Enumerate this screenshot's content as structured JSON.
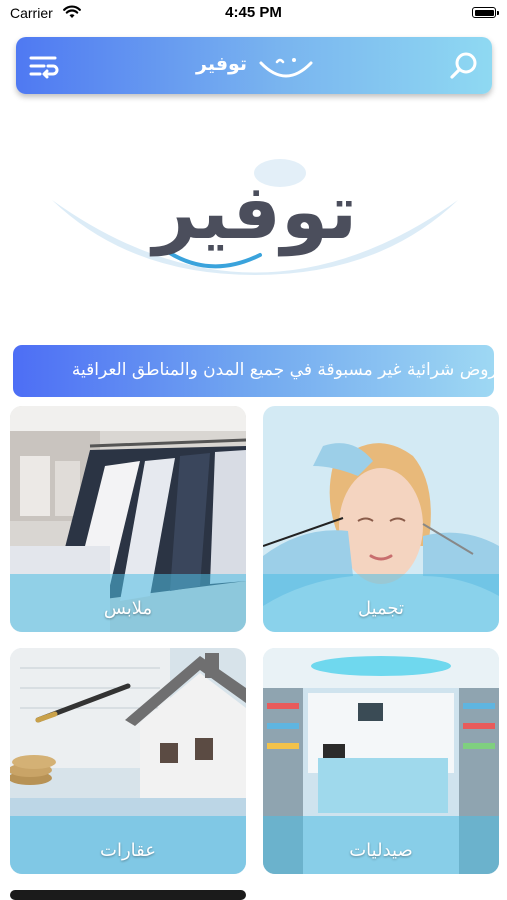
{
  "status_bar": {
    "carrier": "Carrier",
    "time": "4:45 PM"
  },
  "header": {
    "brand": "توفير",
    "menu_icon": "menu-swap-icon",
    "search_icon": "search-icon",
    "gradient": [
      "#4f79f2",
      "#8fd9f2"
    ]
  },
  "logo": {
    "text": "توفير"
  },
  "banner": {
    "text": "عروض شرائية غير مسبوقة في جميع المدن والمناطق العراقية"
  },
  "categories": [
    {
      "label": "ملابس"
    },
    {
      "label": "تجميل"
    },
    {
      "label": "عقارات"
    },
    {
      "label": "صيدليات"
    }
  ],
  "colors": {
    "accent": "#4f79f2",
    "label_band": "#4ebee4",
    "logo_text": "#4b4e5c"
  }
}
